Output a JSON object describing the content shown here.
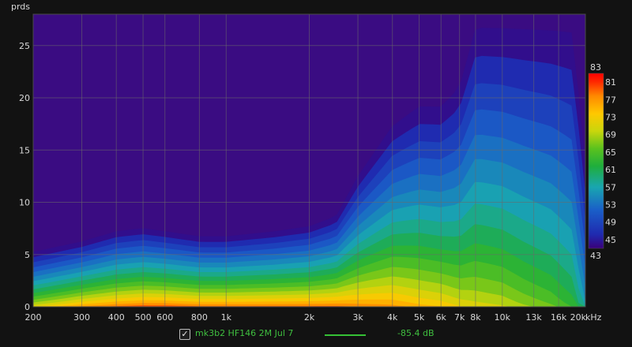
{
  "chart_data": {
    "type": "heatmap",
    "ylabel": "prds",
    "xunit": "kHz",
    "x_scale": "log",
    "xlim": [
      200,
      20000
    ],
    "ylim": [
      0,
      28
    ],
    "x_ticks": [
      {
        "value": 200,
        "label": "200"
      },
      {
        "value": 300,
        "label": "300"
      },
      {
        "value": 400,
        "label": "400"
      },
      {
        "value": 500,
        "label": "500"
      },
      {
        "value": 600,
        "label": "600"
      },
      {
        "value": 800,
        "label": "800"
      },
      {
        "value": 1000,
        "label": "1k"
      },
      {
        "value": 2000,
        "label": "2k"
      },
      {
        "value": 3000,
        "label": "3k"
      },
      {
        "value": 4000,
        "label": "4k"
      },
      {
        "value": 5000,
        "label": "5k"
      },
      {
        "value": 6000,
        "label": "6k"
      },
      {
        "value": 7000,
        "label": "7k"
      },
      {
        "value": 8000,
        "label": "8k"
      },
      {
        "value": 10000,
        "label": "10k"
      },
      {
        "value": 13000,
        "label": "13k"
      },
      {
        "value": 16000,
        "label": "16k"
      },
      {
        "value": 20000,
        "label": "20k"
      }
    ],
    "y_ticks": [
      0,
      5,
      10,
      15,
      20,
      25
    ],
    "colorbar": {
      "min": 43,
      "max": 83,
      "labels": [
        83,
        81,
        77,
        73,
        69,
        65,
        61,
        57,
        53,
        49,
        45,
        43
      ]
    },
    "decay_profile": {
      "freq": [
        200,
        300,
        400,
        500,
        600,
        800,
        1000,
        1500,
        2000,
        2500,
        3000,
        4000,
        5000,
        6000,
        7000,
        8000,
        10000,
        12000,
        15000,
        18000,
        20000
      ],
      "peak_level": [
        74,
        79,
        81,
        82,
        82,
        81,
        81,
        81,
        81,
        81,
        80,
        79,
        77,
        76,
        74,
        73,
        72,
        70,
        68,
        65,
        58
      ],
      "decay_extent_prds": [
        5.5,
        6.5,
        7.5,
        7.8,
        7.5,
        7.0,
        7.0,
        7.5,
        8.0,
        9.0,
        13.0,
        18.0,
        20.0,
        20.0,
        22.0,
        28.0,
        28.0,
        28.0,
        28.0,
        28.0,
        15.0
      ]
    }
  },
  "legend": {
    "checked_glyph": "✓",
    "series_name": "mk3b2 HF146 2M Jul 7",
    "series_color": "#35c135",
    "series_level": "-85.4 dB"
  }
}
